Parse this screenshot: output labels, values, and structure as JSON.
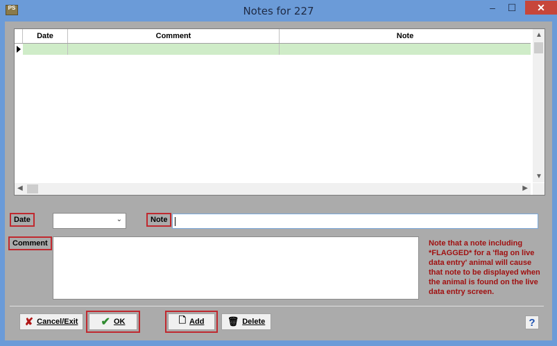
{
  "window": {
    "title": "Notes for 227",
    "app_icon_label": "PS",
    "minimize_glyph": "–",
    "maximize_glyph": "☐",
    "close_glyph": "✕"
  },
  "grid": {
    "columns": [
      "Date",
      "Comment",
      "Note"
    ],
    "rows": [
      {
        "date": "",
        "comment": "",
        "note": ""
      }
    ],
    "selected_row_color": "#cfecc8"
  },
  "form": {
    "date_label": "Date",
    "date_value": "",
    "note_label": "Note",
    "note_value": "",
    "comment_label": "Comment",
    "comment_value": "",
    "warning_text": "Note that a note including *FLAGGED* for a 'flag on live data entry' animal will cause that note to be displayed when the animal is found on the live data entry screen."
  },
  "buttons": {
    "cancel_label": "Cancel/Exit",
    "ok_label": "OK",
    "add_label": "Add",
    "delete_label": "Delete",
    "help_glyph": "?"
  },
  "colors": {
    "window_frame": "#6b9bd8",
    "client_bg": "#ababab",
    "highlight_border": "#c0282e",
    "warning_text": "#a01010",
    "close_button": "#c7463a"
  }
}
